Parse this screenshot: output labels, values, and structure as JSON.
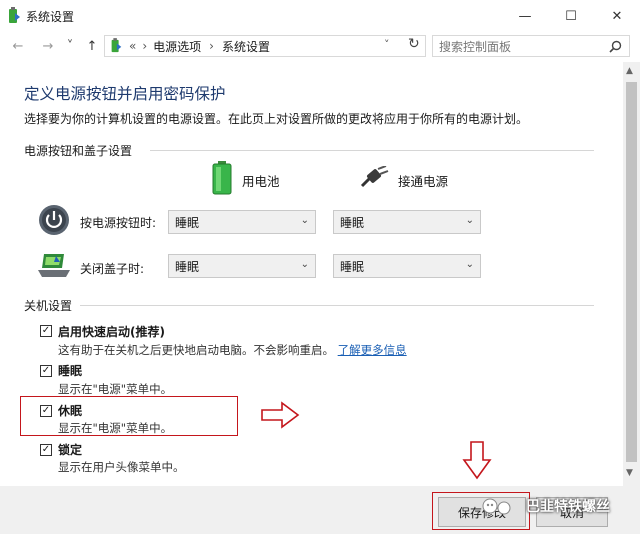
{
  "window": {
    "title": "系统设置",
    "minimize": "—",
    "maximize": "☐",
    "close": "✕"
  },
  "nav": {
    "back": "←",
    "forward": "→",
    "recent": "˅",
    "up": "↑",
    "overflow": "«",
    "breadcrumb": [
      "电源选项",
      "系统设置"
    ],
    "separator": "›",
    "dropdown": "˅",
    "refresh": "↻",
    "search_placeholder": "搜索控制面板"
  },
  "page": {
    "heading": "定义电源按钮并启用密码保护",
    "description": "选择要为你的计算机设置的电源设置。在此页上对设置所做的更改将应用于你所有的电源计划。"
  },
  "power_section": {
    "title": "电源按钮和盖子设置",
    "col_battery": "用电池",
    "col_plugged": "接通电源",
    "rows": [
      {
        "label": "按电源按钮时:",
        "battery": "睡眠",
        "plugged": "睡眠"
      },
      {
        "label": "关闭盖子时:",
        "battery": "睡眠",
        "plugged": "睡眠"
      }
    ]
  },
  "shutdown_section": {
    "title": "关机设置",
    "options": [
      {
        "label": "启用快速启动(推荐)",
        "desc": "这有助于在关机之后更快地启动电脑。不会影响重启。",
        "link": "了解更多信息",
        "checked": true
      },
      {
        "label": "睡眠",
        "desc": "显示在\"电源\"菜单中。",
        "checked": true
      },
      {
        "label": "休眠",
        "desc": "显示在\"电源\"菜单中。",
        "checked": true
      },
      {
        "label": "锁定",
        "desc": "显示在用户头像菜单中。",
        "checked": true
      }
    ]
  },
  "buttons": {
    "save": "保存修改",
    "cancel": "取消"
  },
  "watermark": "巴韭特铁螺丝",
  "colors": {
    "heading": "#1e3a6e",
    "link": "#1a5fb4",
    "highlight": "#c4161c"
  }
}
